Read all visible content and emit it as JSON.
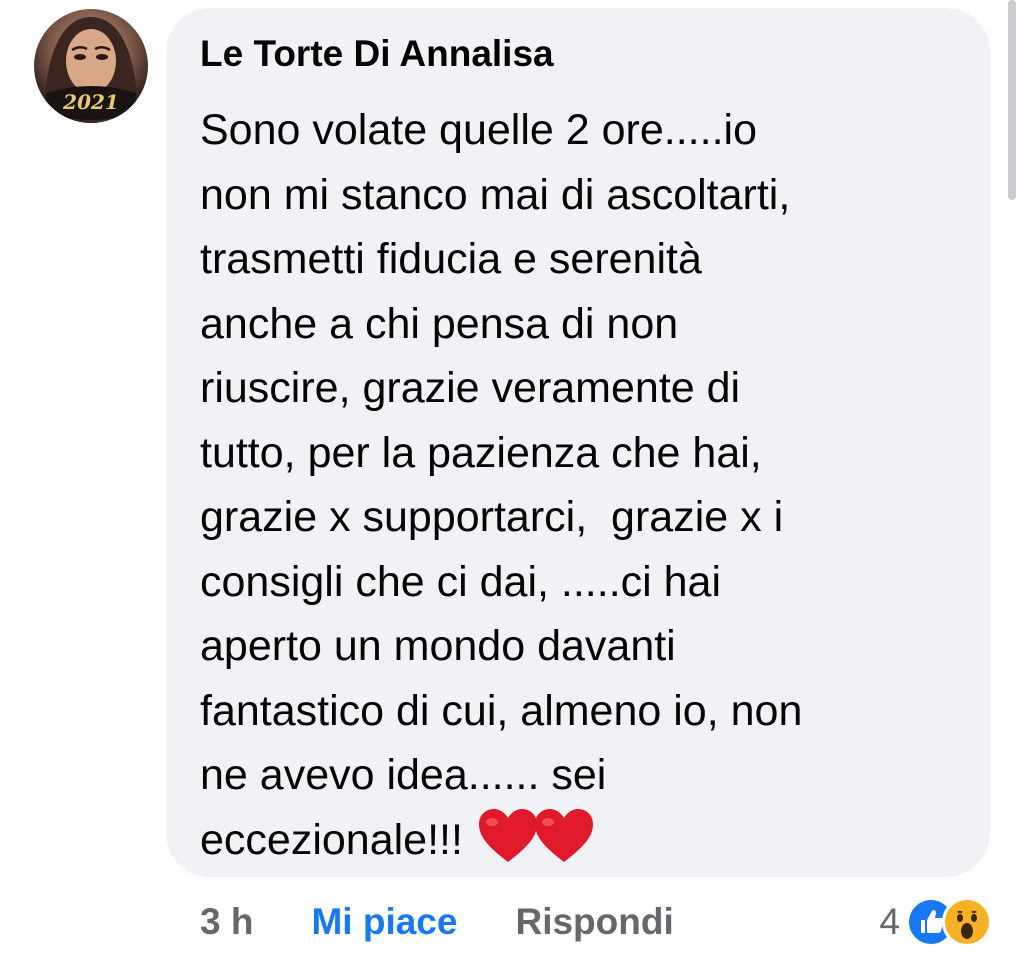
{
  "comment": {
    "author": "Le Torte Di Annalisa",
    "avatar_badge": "2021",
    "text_lines": [
      "Sono volate quelle 2 ore.....io",
      "non mi stanco mai di ascoltarti,",
      "trasmetti fiducia e serenità",
      "anche a chi pensa di non",
      "riuscire, grazie veramente di",
      "tutto, per la pazienza che hai,",
      "grazie x supportarci,  grazie x i",
      "consigli che ci dai, .....ci hai",
      "aperto un mondo davanti",
      "fantastico di cui, almeno io, non",
      "ne avevo idea...... sei",
      "eccezionale!!!"
    ],
    "trailing_emoji": [
      "red-heart-icon",
      "red-heart-icon"
    ]
  },
  "actions": {
    "time": "3 h",
    "like_label": "Mi piace",
    "reply_label": "Rispondi"
  },
  "reactions": {
    "count": "4",
    "icons": [
      "like-icon",
      "wow-icon"
    ]
  },
  "colors": {
    "bubble": "#f0f2f5",
    "text": "#050505",
    "secondary": "#65676b",
    "like_blue": "#1877f2",
    "heart_red": "#e0192b",
    "wow_yellow": "#f7b125"
  }
}
